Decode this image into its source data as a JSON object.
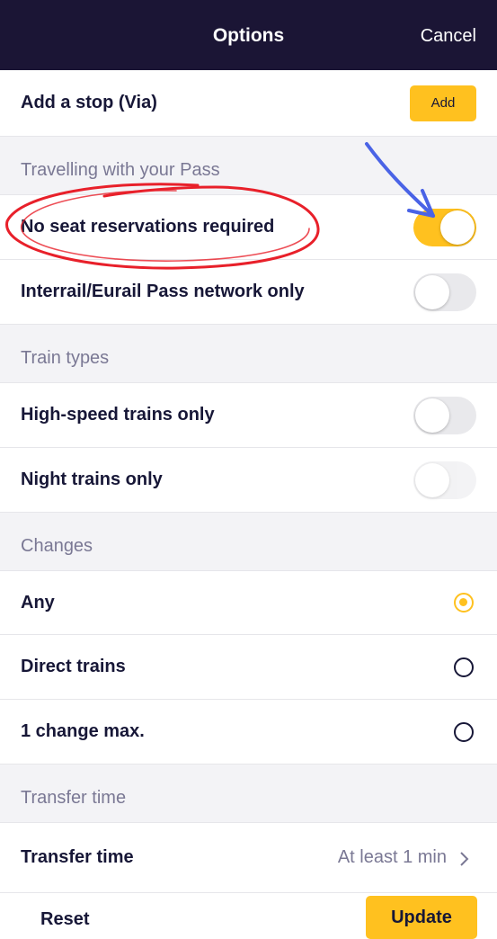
{
  "header": {
    "title": "Options",
    "cancel_label": "Cancel"
  },
  "via": {
    "label": "Add a stop (Via)",
    "button_label": "Add"
  },
  "sections": {
    "pass": "Travelling with your Pass",
    "train_types": "Train types",
    "changes": "Changes",
    "transfer": "Transfer time"
  },
  "pass_options": [
    {
      "label": "No seat reservations required",
      "on": true
    },
    {
      "label": "Interrail/Eurail Pass network only",
      "on": false
    }
  ],
  "train_types": [
    {
      "label": "High-speed trains only",
      "on": false
    },
    {
      "label": "Night trains only",
      "on": false
    }
  ],
  "changes": [
    {
      "label": "Any",
      "selected": true
    },
    {
      "label": "Direct trains",
      "selected": false
    },
    {
      "label": "1 change max.",
      "selected": false
    }
  ],
  "transfer": {
    "label": "Transfer time",
    "value": "At least 1 min"
  },
  "footer": {
    "reset_label": "Reset",
    "update_label": "Update"
  },
  "colors": {
    "header_bg": "#1b1535",
    "accent": "#ffc11f",
    "annotation_circle": "#e8202a",
    "annotation_arrow": "#4a63e6"
  },
  "icons": [
    "chevron-right-icon",
    "annotation-arrow-icon"
  ]
}
